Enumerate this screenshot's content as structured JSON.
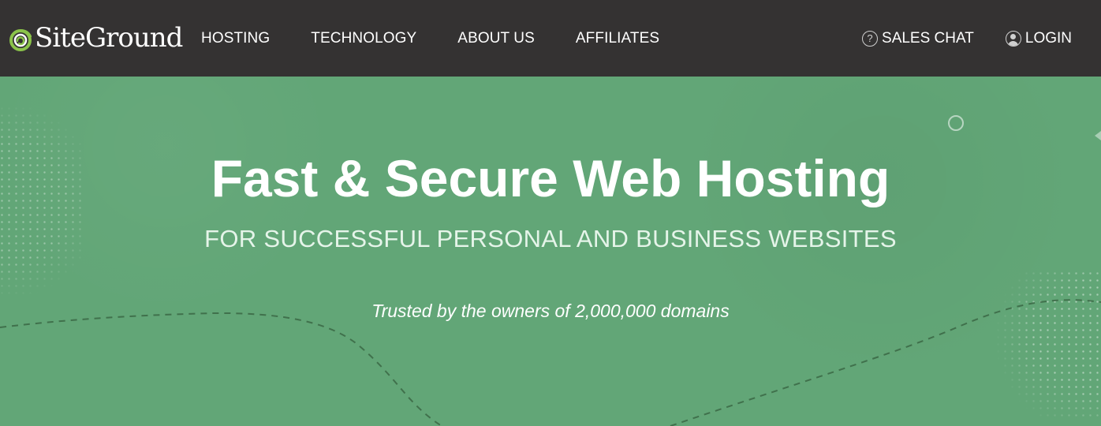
{
  "header": {
    "brand": "SiteGround",
    "nav": [
      {
        "label": "HOSTING"
      },
      {
        "label": "TECHNOLOGY"
      },
      {
        "label": "ABOUT US"
      },
      {
        "label": "AFFILIATES"
      }
    ],
    "right_nav": [
      {
        "label": "SALES CHAT",
        "icon": "question-circle-icon"
      },
      {
        "label": "LOGIN",
        "icon": "user-circle-icon"
      }
    ],
    "colors": {
      "header_bg": "#343232",
      "hero_bg": "#62a677",
      "text": "#ffffff"
    }
  },
  "hero": {
    "title": "Fast & Secure Web Hosting",
    "subtitle": "FOR SUCCESSFUL PERSONAL AND BUSINESS WEBSITES",
    "tagline": "Trusted by the owners of 2,000,000 domains"
  }
}
